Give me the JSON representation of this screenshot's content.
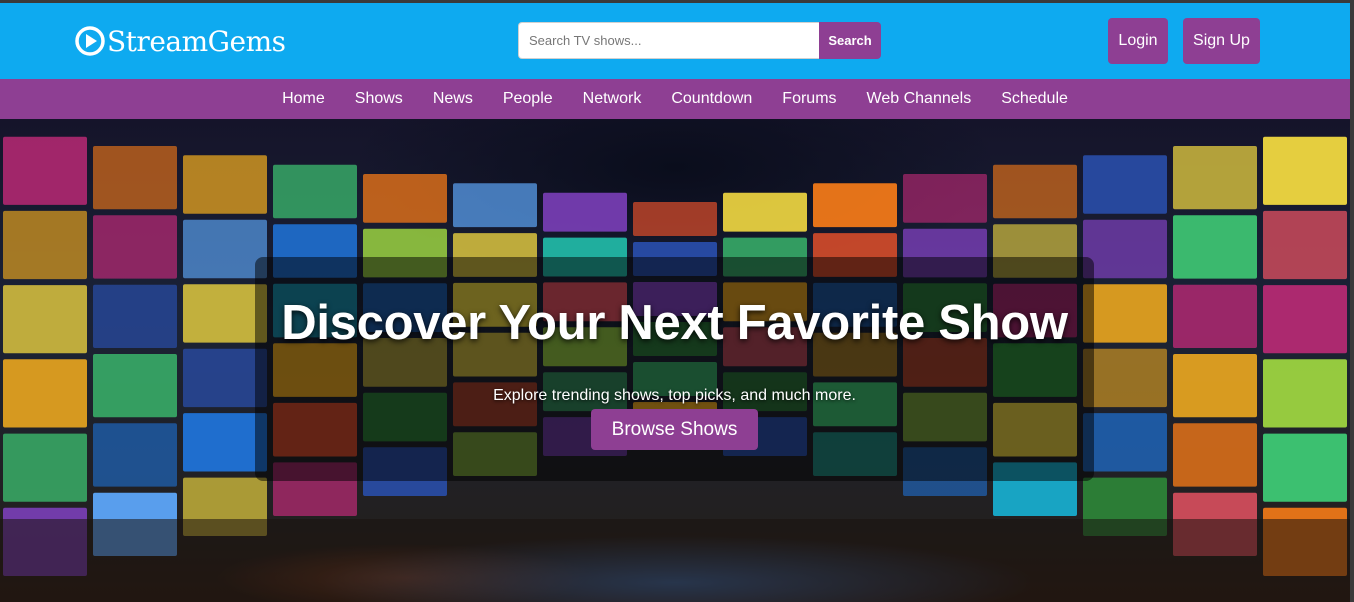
{
  "brand": {
    "name": "StreamGems",
    "logo_icon": "play-circle-icon"
  },
  "search": {
    "placeholder": "Search TV shows...",
    "button_label": "Search"
  },
  "auth": {
    "login_label": "Login",
    "signup_label": "Sign Up"
  },
  "nav": {
    "items": [
      {
        "label": "Home"
      },
      {
        "label": "Shows"
      },
      {
        "label": "News"
      },
      {
        "label": "People"
      },
      {
        "label": "Network"
      },
      {
        "label": "Countdown"
      },
      {
        "label": "Forums"
      },
      {
        "label": "Web Channels"
      },
      {
        "label": "Schedule"
      }
    ]
  },
  "hero": {
    "title": "Discover Your Next Favorite Show",
    "subtitle": "Explore trending shows, top picks, and much more.",
    "cta_label": "Browse Shows",
    "background": "video-wall-room-image"
  },
  "colors": {
    "header_bg": "#0eaaf0",
    "accent_purple": "#8e3f93",
    "text_white": "#ffffff"
  }
}
